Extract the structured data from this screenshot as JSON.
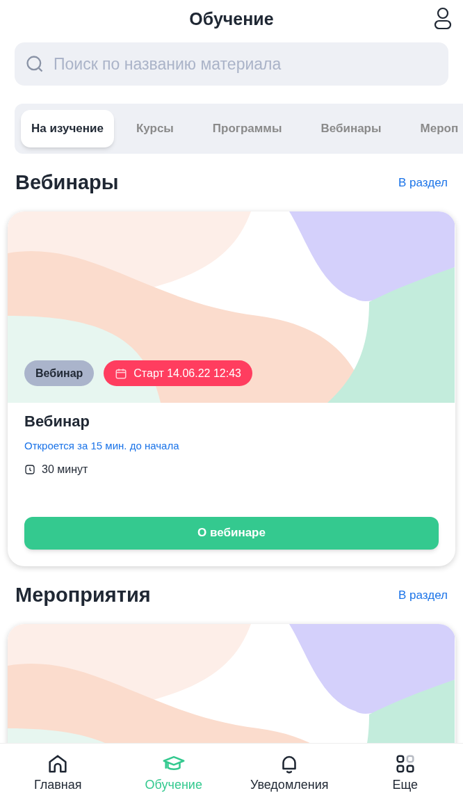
{
  "header": {
    "title": "Обучение"
  },
  "search": {
    "placeholder": "Поиск по названию материала"
  },
  "tabs": [
    {
      "label": "На изучение",
      "selected": true
    },
    {
      "label": "Курсы",
      "selected": false
    },
    {
      "label": "Программы",
      "selected": false
    },
    {
      "label": "Вебинары",
      "selected": false
    },
    {
      "label": "Мероп",
      "selected": false
    }
  ],
  "sections": [
    {
      "title": "Вебинары",
      "link": "В раздел",
      "cards": [
        {
          "kind": "full",
          "type_badge": "Вебинар",
          "start_badge": "Старт 14.06.22 12:43",
          "title": "Вебинар",
          "note": "Откроется за 15 мин. до начала",
          "duration": "30 минут",
          "button": "О вебинаре"
        }
      ]
    },
    {
      "title": "Мероприятия",
      "link": "В раздел",
      "cards": [
        {
          "kind": "banner"
        }
      ]
    }
  ],
  "bottom_nav": [
    {
      "kind": "home",
      "label": "Главная",
      "selected": false
    },
    {
      "kind": "learning",
      "label": "Обучение",
      "selected": true
    },
    {
      "kind": "notifications",
      "label": "Уведомления",
      "selected": false
    },
    {
      "kind": "more",
      "label": "Еще",
      "selected": false
    }
  ]
}
